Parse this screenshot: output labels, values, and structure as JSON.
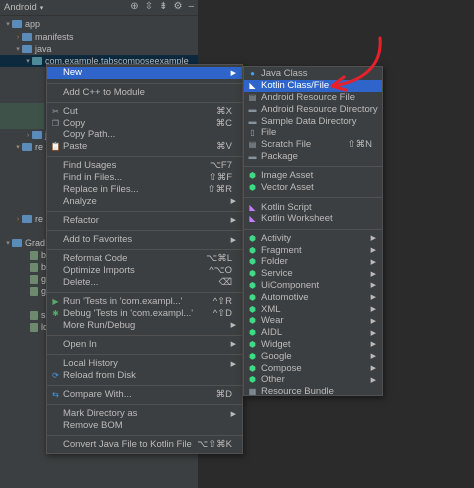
{
  "toolbar": {
    "view": "Android"
  },
  "tree": [
    {
      "label": "app",
      "type": "folder"
    },
    {
      "label": "manifests",
      "type": "folder"
    },
    {
      "label": "java",
      "type": "folder"
    },
    {
      "label": "com.example.tabscomposeexample",
      "type": "package"
    },
    {
      "label": "java",
      "type": "folder"
    },
    {
      "label": "re",
      "type": "folder"
    },
    {
      "label": "re",
      "type": "folder"
    },
    {
      "label": "Grad",
      "type": "folder"
    },
    {
      "label": "bu",
      "type": "file"
    },
    {
      "label": "bu",
      "type": "file"
    },
    {
      "label": "gr",
      "type": "file"
    },
    {
      "label": "gr",
      "type": "file"
    },
    {
      "label": "se",
      "type": "file"
    },
    {
      "label": "lo",
      "type": "file"
    }
  ],
  "context_menu": {
    "items": [
      {
        "label": "New",
        "arrow": true,
        "highlighted": true
      },
      {
        "sep": true
      },
      {
        "label": "Add C++ to Module"
      },
      {
        "sep": true
      },
      {
        "label": "Cut",
        "shortcut": "⌘X",
        "icon": "cut-icon"
      },
      {
        "label": "Copy",
        "shortcut": "⌘C",
        "icon": "copy-icon"
      },
      {
        "label": "Copy Path...",
        "shortcut": ""
      },
      {
        "label": "Paste",
        "shortcut": "⌘V",
        "icon": "paste-icon"
      },
      {
        "sep": true
      },
      {
        "label": "Find Usages",
        "shortcut": "⌥F7"
      },
      {
        "label": "Find in Files...",
        "shortcut": "⇧⌘F"
      },
      {
        "label": "Replace in Files...",
        "shortcut": "⇧⌘R"
      },
      {
        "label": "Analyze",
        "arrow": true
      },
      {
        "sep": true
      },
      {
        "label": "Refactor",
        "arrow": true
      },
      {
        "sep": true
      },
      {
        "label": "Add to Favorites",
        "arrow": true
      },
      {
        "sep": true
      },
      {
        "label": "Reformat Code",
        "shortcut": "⌥⌘L"
      },
      {
        "label": "Optimize Imports",
        "shortcut": "^⌥O"
      },
      {
        "label": "Delete...",
        "shortcut": "⌫"
      },
      {
        "sep": true
      },
      {
        "label": "Run 'Tests in 'com.exampl...'",
        "shortcut": "^⇧R",
        "icon": "run-icon"
      },
      {
        "label": "Debug 'Tests in 'com.exampl...'",
        "shortcut": "^⇧D",
        "icon": "debug-icon"
      },
      {
        "label": "More Run/Debug",
        "arrow": true
      },
      {
        "sep": true
      },
      {
        "label": "Open In",
        "arrow": true
      },
      {
        "sep": true
      },
      {
        "label": "Local History",
        "arrow": true
      },
      {
        "label": "Reload from Disk",
        "icon": "reload-icon"
      },
      {
        "sep": true
      },
      {
        "label": "Compare With...",
        "shortcut": "⌘D",
        "icon": "compare-icon"
      },
      {
        "sep": true
      },
      {
        "label": "Mark Directory as",
        "arrow": true
      },
      {
        "label": "Remove BOM"
      },
      {
        "sep": true
      },
      {
        "label": "Convert Java File to Kotlin File",
        "shortcut": "⌥⇧⌘K"
      }
    ]
  },
  "submenu": {
    "items": [
      {
        "label": "Java Class",
        "icon": "java-class-icon"
      },
      {
        "label": "Kotlin Class/File",
        "icon": "kotlin-icon",
        "highlighted": true
      },
      {
        "label": "Android Resource File",
        "icon": "android-resource-file-icon"
      },
      {
        "label": "Android Resource Directory",
        "icon": "folder-icon"
      },
      {
        "label": "Sample Data Directory",
        "icon": "folder-icon"
      },
      {
        "label": "File",
        "icon": "file-icon"
      },
      {
        "label": "Scratch File",
        "shortcut": "⇧⌘N",
        "icon": "scratch-file-icon"
      },
      {
        "label": "Package",
        "icon": "package-icon"
      },
      {
        "sep": true
      },
      {
        "label": "Image Asset",
        "icon": "android-icon"
      },
      {
        "label": "Vector Asset",
        "icon": "android-icon"
      },
      {
        "sep": true
      },
      {
        "label": "Kotlin Script",
        "icon": "kotlin-script-icon"
      },
      {
        "label": "Kotlin Worksheet",
        "icon": "kotlin-worksheet-icon"
      },
      {
        "sep": true
      },
      {
        "label": "Activity",
        "arrow": true,
        "icon": "android-icon"
      },
      {
        "label": "Fragment",
        "arrow": true,
        "icon": "android-icon"
      },
      {
        "label": "Folder",
        "arrow": true,
        "icon": "android-icon"
      },
      {
        "label": "Service",
        "arrow": true,
        "icon": "android-icon"
      },
      {
        "label": "UiComponent",
        "arrow": true,
        "icon": "android-icon"
      },
      {
        "label": "Automotive",
        "arrow": true,
        "icon": "android-icon"
      },
      {
        "label": "XML",
        "arrow": true,
        "icon": "android-icon"
      },
      {
        "label": "Wear",
        "arrow": true,
        "icon": "android-icon"
      },
      {
        "label": "AIDL",
        "arrow": true,
        "icon": "android-icon"
      },
      {
        "label": "Widget",
        "arrow": true,
        "icon": "android-icon"
      },
      {
        "label": "Google",
        "arrow": true,
        "icon": "android-icon"
      },
      {
        "label": "Compose",
        "arrow": true,
        "icon": "android-icon"
      },
      {
        "label": "Other",
        "arrow": true,
        "icon": "android-icon"
      },
      {
        "label": "Resource Bundle",
        "icon": "resource-bundle-icon"
      }
    ]
  },
  "colors": {
    "highlight": "#2f65ca",
    "menu_bg": "#3c3f41",
    "editor_bg": "#2b2b2b",
    "annotation": "#e8202a"
  }
}
